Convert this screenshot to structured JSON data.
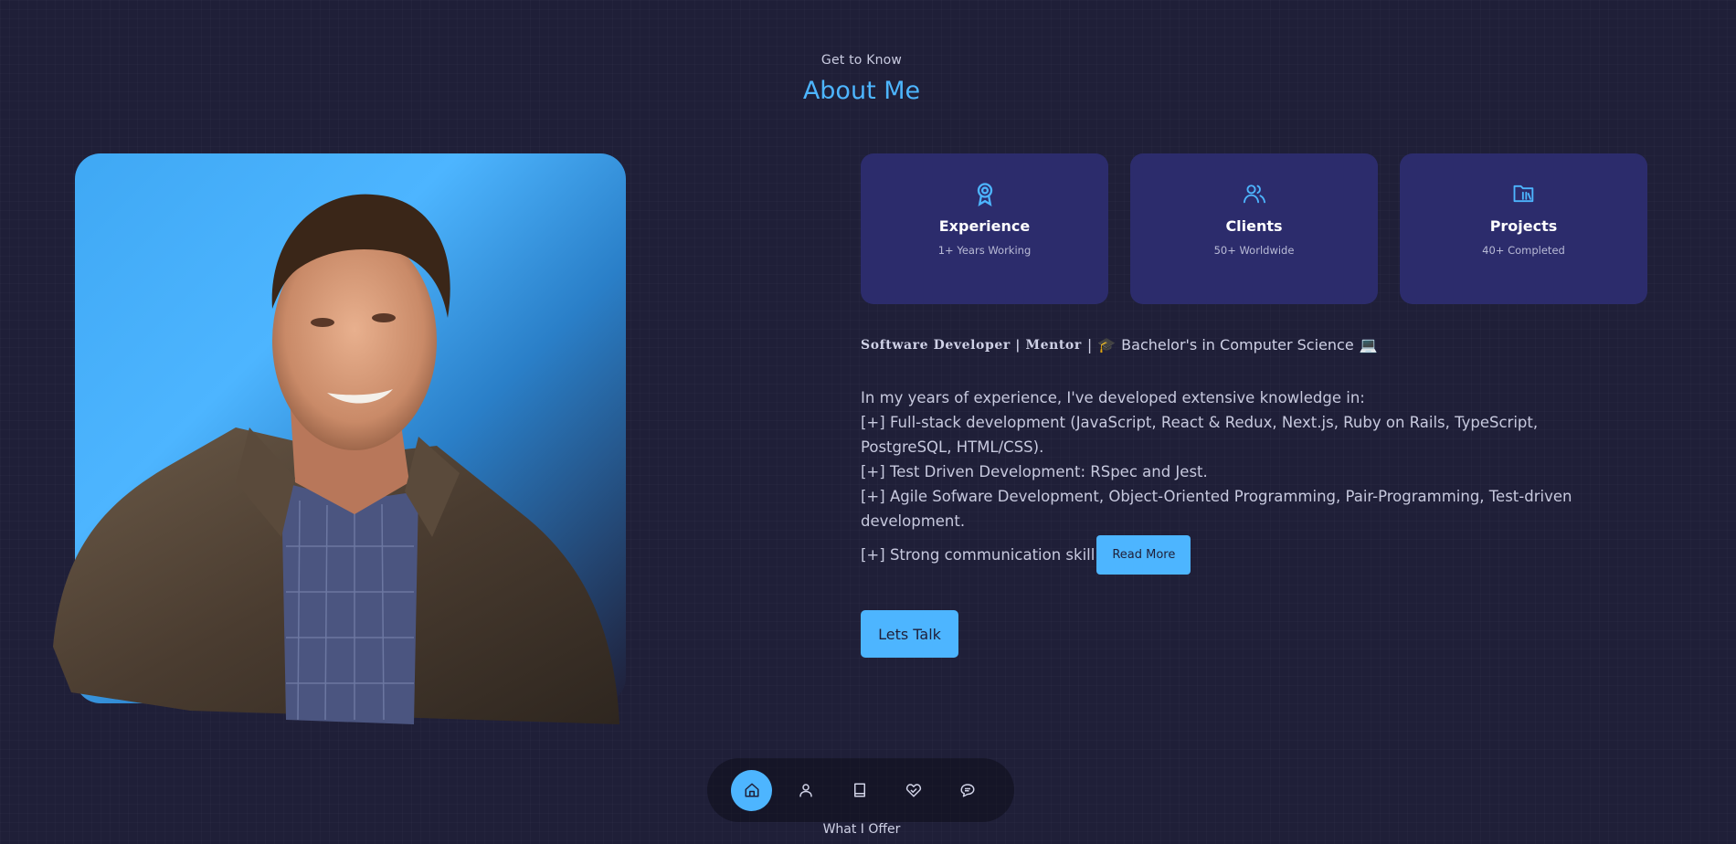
{
  "header": {
    "subtitle": "Get to Know",
    "title": "About Me"
  },
  "photo": {
    "alt": "Portrait photo",
    "icon": "profile-photo"
  },
  "cards": [
    {
      "icon": "award-icon",
      "title": "Experience",
      "sub": "1+ Years Working"
    },
    {
      "icon": "users-icon",
      "title": "Clients",
      "sub": "50+ Worldwide"
    },
    {
      "icon": "folder-icon",
      "title": "Projects",
      "sub": "40+ Completed"
    }
  ],
  "tagline": {
    "role": "Software Developer | Mentor",
    "separator": "|",
    "cap": "🎓",
    "degree": "Bachelor's in Computer Science",
    "computer": "💻"
  },
  "about": {
    "intro": "In my years of experience, I've developed extensive knowledge in:",
    "lines": [
      "[+] Full-stack development (JavaScript, React & Redux, Next.js, Ruby on Rails, TypeScript, PostgreSQL, HTML/CSS).",
      "[+] Test Driven Development: RSpec and Jest.",
      "[+] Agile Sofware Development, Object-Oriented Programming, Pair-Programming, Test-driven development."
    ],
    "last_line": "[+] Strong communication skill",
    "read_more": "Read More"
  },
  "cta": {
    "lets_talk": "Lets Talk"
  },
  "nav": {
    "items": [
      "home-icon",
      "user-icon",
      "book-icon",
      "services-icon",
      "message-icon"
    ],
    "active": 0
  },
  "next_section": "What I Offer",
  "colors": {
    "accent": "#4db5ff",
    "bg": "#1f1f38",
    "card": "#2c2c6c"
  }
}
